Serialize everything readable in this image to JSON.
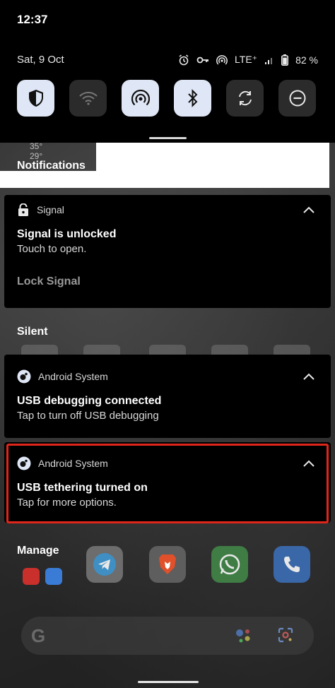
{
  "status_bar": {
    "time": "12:37"
  },
  "quick_settings": {
    "date": "Sat, 9 Oct",
    "network": "LTE⁺",
    "battery": "82 %",
    "tiles": [
      {
        "name": "shield-tile",
        "icon": "shield-icon",
        "state": "on"
      },
      {
        "name": "wifi-tile",
        "icon": "wifi-icon",
        "state": "off"
      },
      {
        "name": "hotspot-tile",
        "icon": "hotspot-icon",
        "state": "on"
      },
      {
        "name": "bluetooth-tile",
        "icon": "bluetooth-icon",
        "state": "on"
      },
      {
        "name": "auto-rotate-tile",
        "icon": "rotate-icon",
        "state": "off"
      },
      {
        "name": "dnd-tile",
        "icon": "do-not-disturb-icon",
        "state": "off"
      }
    ]
  },
  "wallpaper_weather": {
    "line1": "35°",
    "line2": "29°"
  },
  "notifications": {
    "header": "Notifications",
    "signal": {
      "app": "Signal",
      "title": "Signal is unlocked",
      "text": "Touch to open.",
      "action": "Lock Signal"
    }
  },
  "silent": {
    "header": "Silent",
    "items": [
      {
        "app": "Android System",
        "title": "USB debugging connected",
        "text": "Tap to turn off USB debugging"
      },
      {
        "app": "Android System",
        "title": "USB tethering turned on",
        "text": "Tap for more options."
      }
    ]
  },
  "manage_label": "Manage",
  "colors": {
    "highlight": "#e0261b",
    "tile_on": "#dfe6f5",
    "tile_off": "#2b2b2b"
  }
}
